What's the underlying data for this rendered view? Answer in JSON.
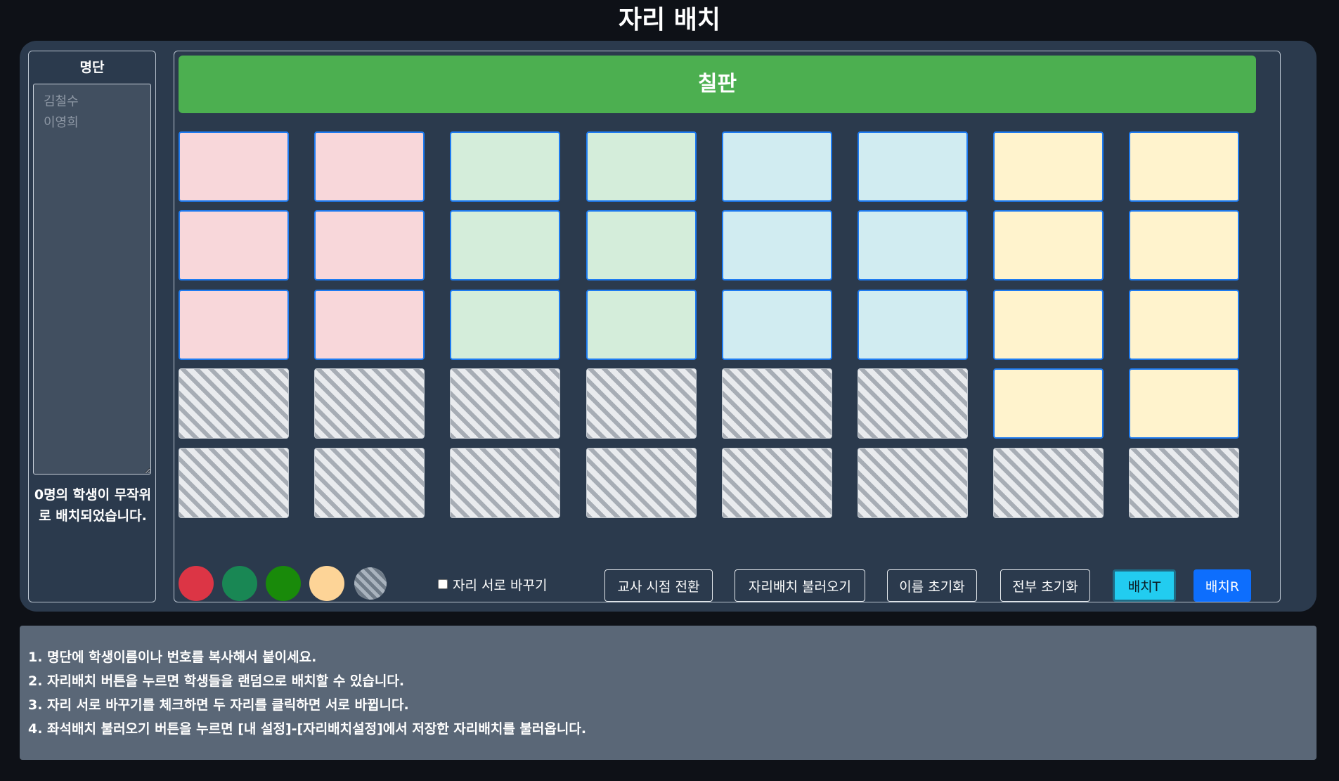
{
  "page": {
    "title": "자리 배치"
  },
  "roster": {
    "label": "명단",
    "placeholder": "김철수\n이영희",
    "value": "",
    "status": "0명의 학생이 무작위로 배치되었습니다."
  },
  "classroom": {
    "blackboard_label": "칠판",
    "group_colors": {
      "red": "#f8d7da",
      "green": "#d4edda",
      "blue": "#d1ecf1",
      "yellow": "#fff3cd"
    },
    "rows": [
      [
        "red",
        "red",
        "green",
        "green",
        "blue",
        "blue",
        "yellow",
        "yellow"
      ],
      [
        "red",
        "red",
        "green",
        "green",
        "blue",
        "blue",
        "yellow",
        "yellow"
      ],
      [
        "red",
        "red",
        "green",
        "green",
        "blue",
        "blue",
        "yellow",
        "yellow"
      ],
      [
        "disabled",
        "disabled",
        "disabled",
        "disabled",
        "disabled",
        "disabled",
        "yellow",
        "yellow"
      ],
      [
        "disabled",
        "disabled",
        "disabled",
        "disabled",
        "disabled",
        "disabled",
        "disabled",
        "disabled"
      ]
    ]
  },
  "palette": [
    {
      "name": "red-swatch",
      "color": "#dc3545"
    },
    {
      "name": "teal-green-swatch",
      "color": "#198754"
    },
    {
      "name": "green-swatch",
      "color": "#198a0a"
    },
    {
      "name": "peach-swatch",
      "color": "#fdd497"
    },
    {
      "name": "striped-swatch",
      "color": "striped"
    }
  ],
  "controls": {
    "swap_label": "자리 서로 바꾸기",
    "teacher_view": "교사 시점 전환",
    "load_seating": "자리배치 불러오기",
    "reset_names": "이름 초기화",
    "reset_all": "전부 초기화",
    "assign_t": "배치T",
    "assign_r": "배치R"
  },
  "instructions": [
    "1. 명단에 학생이름이나 번호를 복사해서 붙이세요.",
    "2. 자리배치 버튼을 누르면 학생들을 랜덤으로 배치할 수 있습니다.",
    "3. 자리 서로 바꾸기를 체크하면 두 자리를 클릭하면 서로 바뀝니다.",
    "4. 좌석배치 불러오기 버튼을 누르면 [내 설정]-[자리배치설정]에서 저장한 자리배치를 불러옵니다."
  ]
}
